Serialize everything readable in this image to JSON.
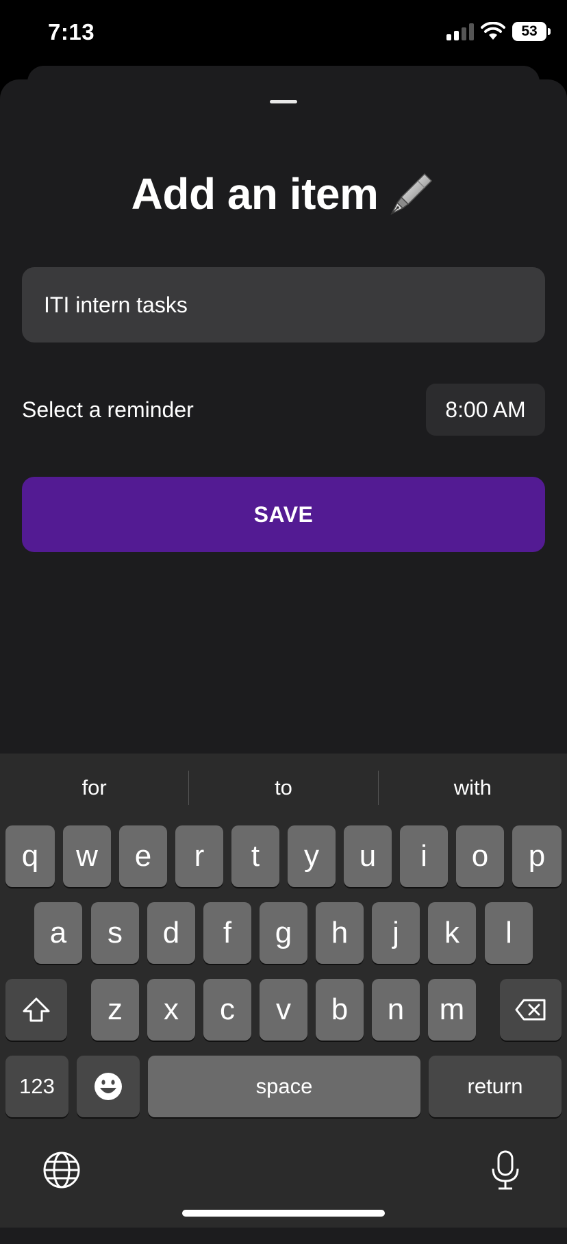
{
  "status_bar": {
    "time": "7:13",
    "battery": "53"
  },
  "sheet": {
    "title": "Add an item",
    "title_icon": "fountain-pen-icon",
    "name_input_value": "ITI intern tasks",
    "reminder_label": "Select a reminder",
    "reminder_time": "8:00 AM",
    "save_label": "SAVE",
    "accent_color": "#531b93"
  },
  "keyboard": {
    "suggestions": [
      "for",
      "to",
      "with"
    ],
    "row1": [
      "q",
      "w",
      "e",
      "r",
      "t",
      "y",
      "u",
      "i",
      "o",
      "p"
    ],
    "row2": [
      "a",
      "s",
      "d",
      "f",
      "g",
      "h",
      "j",
      "k",
      "l"
    ],
    "row3": [
      "z",
      "x",
      "c",
      "v",
      "b",
      "n",
      "m"
    ],
    "numbers_label": "123",
    "space_label": "space",
    "return_label": "return"
  }
}
